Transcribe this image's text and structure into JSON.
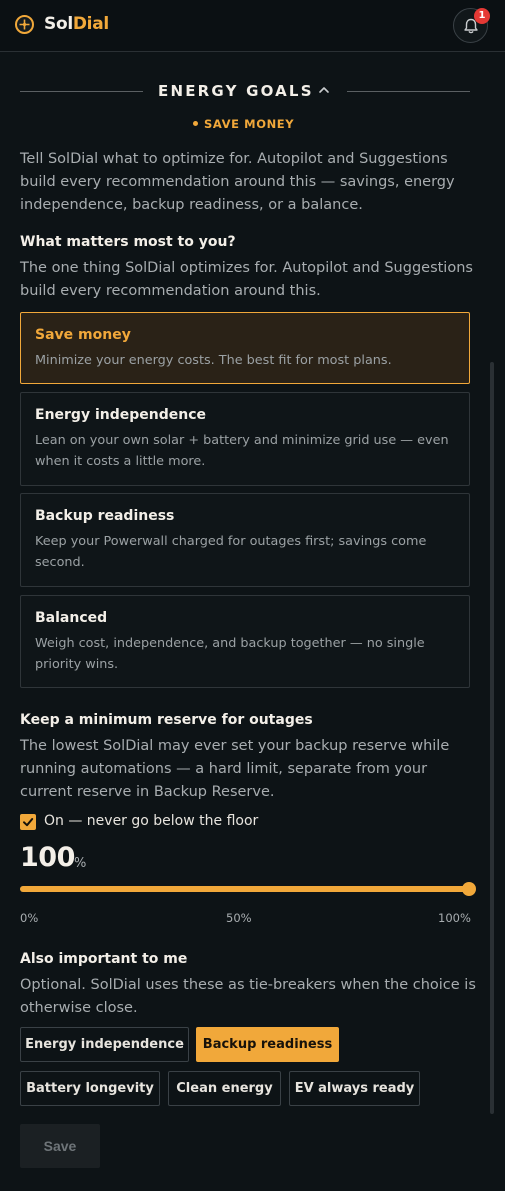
{
  "header": {
    "brand_part1": "Sol",
    "brand_part2": "Dial",
    "notification_count": "1"
  },
  "section": {
    "title": "ENERGY GOALS",
    "status": "SAVE MONEY",
    "intro": "Tell SolDial what to optimize for. Autopilot and Suggestions build every recommendation around this — savings, energy independence, backup readiness, or a balance."
  },
  "priority": {
    "heading": "What matters most to you?",
    "description": "The one thing SolDial optimizes for. Autopilot and Suggestions build every recommendation around this.",
    "options": [
      {
        "title": "Save money",
        "desc": "Minimize your energy costs. The best fit for most plans.",
        "selected": true
      },
      {
        "title": "Energy independence",
        "desc": "Lean on your own solar + battery and minimize grid use — even when it costs a little more.",
        "selected": false
      },
      {
        "title": "Backup readiness",
        "desc": "Keep your Powerwall charged for outages first; savings come second.",
        "selected": false
      },
      {
        "title": "Balanced",
        "desc": "Weigh cost, independence, and backup together — no single priority wins.",
        "selected": false
      }
    ]
  },
  "reserve": {
    "heading": "Keep a minimum reserve for outages",
    "description": "The lowest SolDial may ever set your backup reserve while running automations — a hard limit, separate from your current reserve in Backup Reserve.",
    "checkbox_label": "On — never go below the floor",
    "checked": true,
    "value": "100",
    "unit": "%",
    "slider_fraction": 1.0,
    "tick_min": "0%",
    "tick_mid": "50%",
    "tick_max": "100%"
  },
  "secondary": {
    "heading": "Also important to me",
    "description": "Optional. SolDial uses these as tie-breakers when the choice is otherwise close.",
    "chips": [
      {
        "label": "Energy independence",
        "active": false
      },
      {
        "label": "Backup readiness",
        "active": true
      },
      {
        "label": "Battery longevity",
        "active": false
      },
      {
        "label": "Clean energy",
        "active": false
      },
      {
        "label": "EV always ready",
        "active": false
      }
    ]
  },
  "actions": {
    "save_label": "Save"
  },
  "colors": {
    "accent": "#f1a83a",
    "background": "#0d1316",
    "badge": "#e53935"
  }
}
